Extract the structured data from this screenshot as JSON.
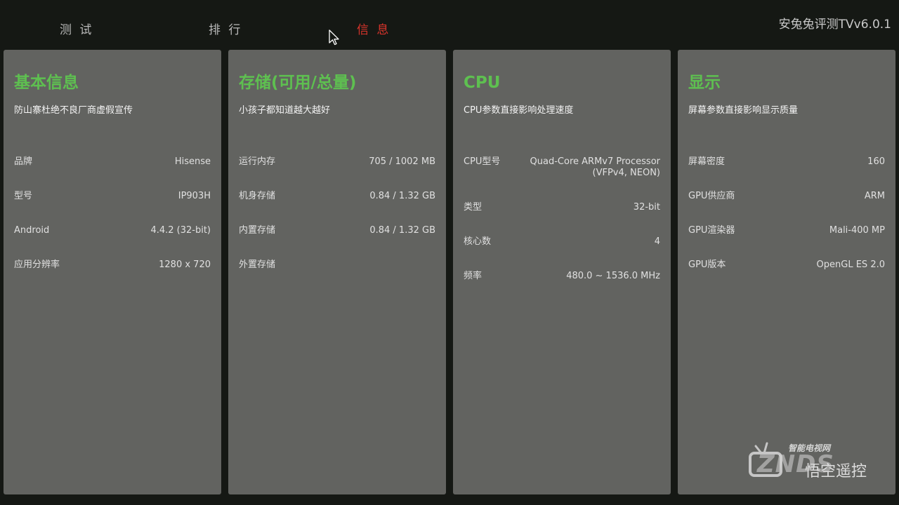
{
  "nav": {
    "tabs": [
      {
        "label": "测 试"
      },
      {
        "label": "排 行"
      },
      {
        "label": "信 息"
      }
    ],
    "active_tab": 2,
    "active_color": "#d9342b"
  },
  "app_title": "安兔兔评测TVv6.0.1",
  "accent_color": "#5ec050",
  "panels": [
    {
      "title": "基本信息",
      "subtitle": "防山寨杜绝不良厂商虚假宣传",
      "rows": [
        {
          "key": "品牌",
          "value": "Hisense"
        },
        {
          "key": "型号",
          "value": "IP903H"
        },
        {
          "key": "Android",
          "value": "4.4.2 (32-bit)"
        },
        {
          "key": "应用分辨率",
          "value": "1280 x 720"
        }
      ]
    },
    {
      "title": "存储(可用/总量)",
      "subtitle": "小孩子都知道越大越好",
      "rows": [
        {
          "key": "运行内存",
          "value": "705 / 1002 MB"
        },
        {
          "key": "机身存储",
          "value": "0.84 / 1.32 GB"
        },
        {
          "key": "内置存储",
          "value": "0.84 / 1.32 GB"
        },
        {
          "key": "外置存储",
          "value": ""
        }
      ]
    },
    {
      "title": "CPU",
      "subtitle": "CPU参数直接影响处理速度",
      "rows": [
        {
          "key": "CPU型号",
          "value": "Quad-Core ARMv7 Processor (VFPv4, NEON)"
        },
        {
          "key": "类型",
          "value": "32-bit"
        },
        {
          "key": "核心数",
          "value": "4"
        },
        {
          "key": "频率",
          "value": "480.0 ~ 1536.0 MHz"
        }
      ]
    },
    {
      "title": "显示",
      "subtitle": "屏幕参数直接影响显示质量",
      "rows": [
        {
          "key": "屏幕密度",
          "value": "160"
        },
        {
          "key": "GPU供应商",
          "value": "ARM"
        },
        {
          "key": "GPU渲染器",
          "value": "Mali-400 MP"
        },
        {
          "key": "GPU版本",
          "value": "OpenGL ES 2.0"
        }
      ]
    }
  ],
  "watermark": {
    "top": "智能电视网",
    "big": "ZNDS",
    "sub": "悟空遥控"
  }
}
